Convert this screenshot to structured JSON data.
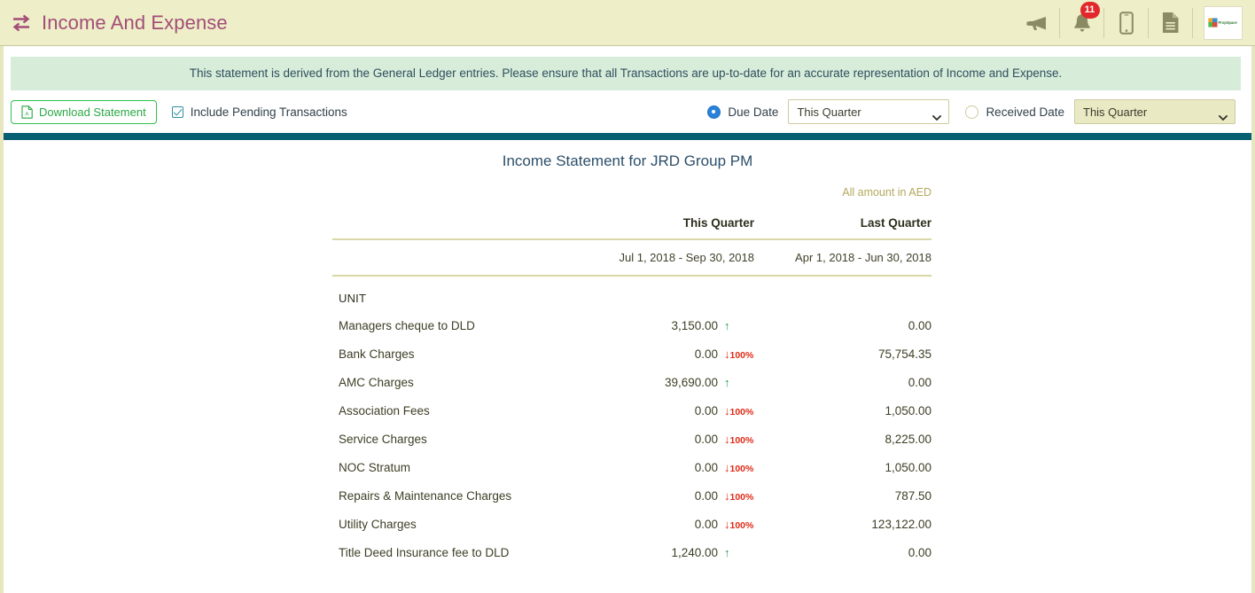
{
  "header": {
    "title": "Income And Expense",
    "icon": "exchange-arrows-icon",
    "accent_color": "#a34d77",
    "background_color": "#eeefc9",
    "actions": [
      {
        "name": "announcements-icon",
        "label": "Announcements"
      },
      {
        "name": "notifications-bell-icon",
        "label": "Notifications",
        "badge": "11",
        "badge_color": "#e2282a"
      },
      {
        "name": "mobile-app-icon",
        "label": "Mobile App"
      },
      {
        "name": "documents-icon",
        "label": "Documents"
      }
    ],
    "brand": {
      "name": "brand-logo",
      "text": "PropSpace"
    }
  },
  "banner": {
    "text": "This statement is derived from the General Ledger entries. Please ensure that all Transactions are up-to-date for an accurate representation of Income and Expense.",
    "background_color": "#d7ecd9"
  },
  "toolbar": {
    "download_label": "Download Statement",
    "download_color": "#2aa845",
    "include_pending_label": "Include Pending Transactions",
    "include_pending_checked": true,
    "due_date": {
      "label": "Due Date",
      "selected": true,
      "value": "This Quarter",
      "enabled": true
    },
    "received_date": {
      "label": "Received Date",
      "selected": false,
      "value": "This Quarter",
      "enabled": false
    },
    "rule_color": "#066072"
  },
  "statement": {
    "title": "Income Statement for JRD Group PM",
    "currency_note": "All amount in AED",
    "columns": {
      "name": "",
      "this_quarter": "This Quarter",
      "last_quarter": "Last Quarter"
    },
    "date_ranges": {
      "this_quarter": "Jul 1, 2018 - Sep 30, 2018",
      "last_quarter": "Apr 1, 2018 - Jun 30, 2018"
    },
    "section_label": "UNIT",
    "rows": [
      {
        "name": "Managers cheque to DLD",
        "this_quarter": "3,150.00",
        "trend": "up",
        "pct": "",
        "last_quarter": "0.00"
      },
      {
        "name": "Bank Charges",
        "this_quarter": "0.00",
        "trend": "down",
        "pct": "100%",
        "last_quarter": "75,754.35"
      },
      {
        "name": "AMC Charges",
        "this_quarter": "39,690.00",
        "trend": "up",
        "pct": "",
        "last_quarter": "0.00"
      },
      {
        "name": "Association Fees",
        "this_quarter": "0.00",
        "trend": "down",
        "pct": "100%",
        "last_quarter": "1,050.00"
      },
      {
        "name": "Service Charges",
        "this_quarter": "0.00",
        "trend": "down",
        "pct": "100%",
        "last_quarter": "8,225.00"
      },
      {
        "name": "NOC Stratum",
        "this_quarter": "0.00",
        "trend": "down",
        "pct": "100%",
        "last_quarter": "1,050.00"
      },
      {
        "name": "Repairs & Maintenance Charges",
        "this_quarter": "0.00",
        "trend": "down",
        "pct": "100%",
        "last_quarter": "787.50"
      },
      {
        "name": "Utility Charges",
        "this_quarter": "0.00",
        "trend": "down",
        "pct": "100%",
        "last_quarter": "123,122.00"
      },
      {
        "name": "Title Deed Insurance fee to DLD",
        "this_quarter": "1,240.00",
        "trend": "up",
        "pct": "",
        "last_quarter": "0.00"
      }
    ],
    "trend_up_color": "#1f9d4e",
    "trend_down_color": "#e02a16"
  }
}
